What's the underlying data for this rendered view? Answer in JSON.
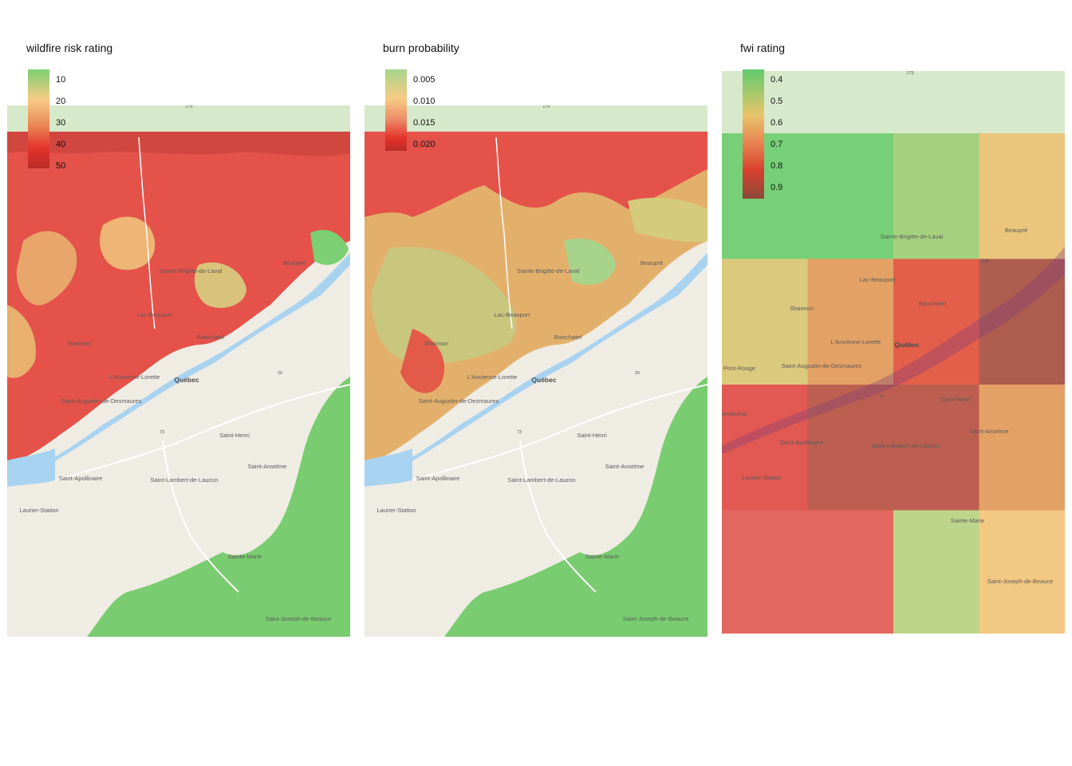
{
  "panels": [
    {
      "id": "wildfire",
      "title": "wildfire risk rating",
      "legend": {
        "ticks": [
          "10",
          "20",
          "30",
          "40",
          "50"
        ],
        "colors": [
          "#7ccf72",
          "#f6cc85",
          "#ea8a59",
          "#e3322b",
          "#b92d26"
        ]
      }
    },
    {
      "id": "burn",
      "title": "burn probability",
      "legend": {
        "ticks": [
          "0.005",
          "0.010",
          "0.015",
          "0.020"
        ],
        "colors": [
          "#a7d58a",
          "#f6cc85",
          "#ee8f6b",
          "#e3322b",
          "#b92d26"
        ]
      }
    },
    {
      "id": "fwi",
      "title": "fwi rating",
      "legend": {
        "ticks": [
          "0.4",
          "0.5",
          "0.6",
          "0.7",
          "0.8",
          "0.9"
        ],
        "colors": [
          "#5fcb6c",
          "#e8c56c",
          "#e88a52",
          "#d9402e",
          "#8a4a3a"
        ]
      },
      "grid": {
        "rows": [
          [
            0.42,
            0.42,
            0.48,
            0.58
          ],
          [
            0.55,
            0.68,
            0.82,
            0.88
          ],
          [
            0.83,
            0.86,
            0.86,
            0.7
          ],
          [
            0.8,
            0.8,
            0.5,
            0.6
          ],
          [
            0.79,
            0.79,
            0.49,
            0.58
          ]
        ],
        "colors": [
          [
            "#6dcc6f",
            "#6dcc6f",
            "#9ecd74",
            "#eac173"
          ],
          [
            "#d9c674",
            "#e39a5a",
            "#e2533d",
            "#a95042"
          ],
          [
            "#e04c45",
            "#b95343",
            "#b95343",
            "#e39a5a"
          ],
          [
            "#e35c57",
            "#e35c57",
            "#b9d382",
            "#f2c47a"
          ],
          [
            "#ee6a6a",
            "#ee6a6a",
            "#c6da8d",
            "#fccd86"
          ]
        ]
      }
    }
  ],
  "places": [
    "Sainte-Brigitte-de-Laval",
    "Beaupré",
    "Lac-Beauport",
    "Boischatel",
    "Shannon",
    "L'Ancienne-Lorette",
    "Québec",
    "Saint-Augustin-de-Desmaures",
    "Saint-Henri",
    "Saint-Anselme",
    "Saint-Apollinaire",
    "Saint-Lambert-de-Lauzon",
    "Laurier-Station",
    "Sainte-Marie",
    "Saint-Joseph-de-Beauce",
    "Pont-Rouge",
    "Donnacona"
  ],
  "road_shields": [
    "175",
    "20",
    "73",
    "40",
    "138"
  ]
}
